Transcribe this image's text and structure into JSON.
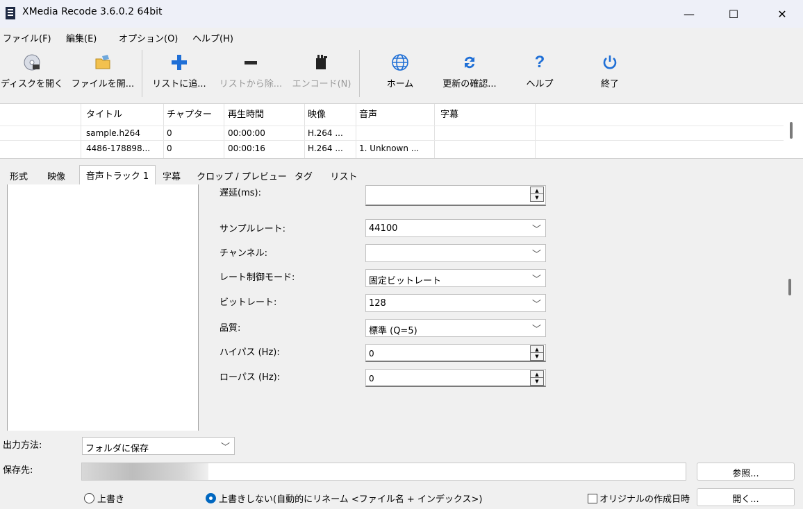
{
  "window": {
    "title": "XMedia Recode 3.6.0.2 64bit",
    "minimize": "—",
    "maximize": "☐",
    "close": "✕"
  },
  "menu": [
    "ファイル(F)",
    "編集(E)",
    "オプション(O)",
    "ヘルプ(H)"
  ],
  "toolbar": {
    "open_disc": "ディスクを開く",
    "open_file": "ファイルを開...",
    "add_list": "リストに追...",
    "remove_list": "リストから除...",
    "encode": "エンコード(N)",
    "home": "ホーム",
    "check_update": "更新の確認...",
    "help": "ヘルプ",
    "exit": "終了"
  },
  "filelist": {
    "headers": [
      "タイトル",
      "チャプター",
      "再生時間",
      "映像",
      "音声",
      "字幕"
    ],
    "rows": [
      [
        "sample.h264",
        "0",
        "00:00:00",
        "H.264 ...",
        "",
        ""
      ],
      [
        "4486-178898...",
        "0",
        "00:00:16",
        "H.264 ...",
        "1. Unknown ...",
        ""
      ]
    ]
  },
  "tabs": [
    "形式",
    "映像",
    "音声トラック 1",
    "字幕",
    "クロップ / プレビュー",
    "タグ",
    "リスト"
  ],
  "audio_form": {
    "delay_label": "遅延(ms):",
    "delay_value": "",
    "samplerate_label": "サンプルレート:",
    "samplerate_value": "44100",
    "channel_label": "チャンネル:",
    "channel_value": "",
    "ratemode_label": "レート制御モード:",
    "ratemode_value": "固定ビットレート",
    "bitrate_label": "ビットレート:",
    "bitrate_value": "128",
    "quality_label": "品質:",
    "quality_value": "標準 (Q=5)",
    "highpass_label": "ハイパス (Hz):",
    "highpass_value": "0",
    "lowpass_label": "ローパス (Hz):",
    "lowpass_value": "0"
  },
  "output": {
    "method_label": "出力方法:",
    "method_value": "フォルダに保存",
    "dest_label": "保存先:",
    "browse": "参照...",
    "open": "開く...",
    "overwrite": "上書き",
    "no_overwrite": "上書きしない(自動的にリネーム <ファイル名 + インデックス>)",
    "keep_original_date": "オリジナルの作成日時"
  }
}
